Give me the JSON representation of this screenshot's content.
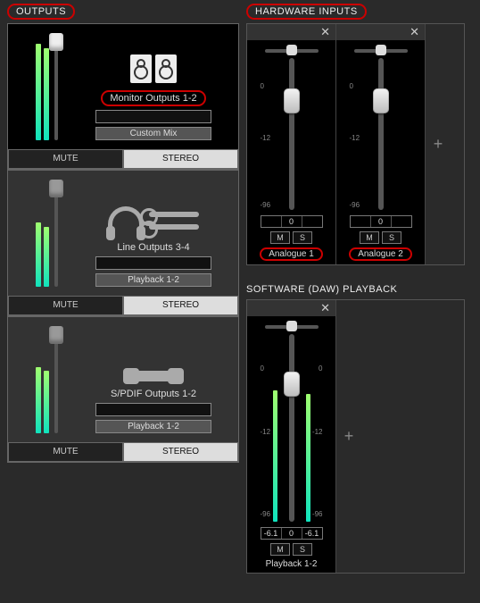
{
  "sections": {
    "outputs_title": "OUTPUTS",
    "hardware_title": "HARDWARE INPUTS",
    "software_title": "SOFTWARE (DAW) PLAYBACK"
  },
  "outputs": [
    {
      "label": "Monitor Outputs 1-2",
      "mix_label": "Custom Mix",
      "mute": "MUTE",
      "stereo": "STEREO",
      "meter_heights": [
        90,
        86
      ],
      "fader_light": true,
      "highlight": true
    },
    {
      "label": "Line Outputs 3-4",
      "mix_label": "Playback 1-2",
      "mute": "MUTE",
      "stereo": "STEREO",
      "meter_heights": [
        60,
        56
      ],
      "fader_light": false,
      "highlight": false
    },
    {
      "label": "S/PDIF Outputs 1-2",
      "mix_label": "Playback 1-2",
      "mute": "MUTE",
      "stereo": "STEREO",
      "meter_heights": [
        62,
        58
      ],
      "fader_light": false,
      "highlight": false
    }
  ],
  "db_scale": {
    "top": "0",
    "mid": "-12",
    "bot": "-96"
  },
  "hardware_inputs": [
    {
      "label": "Analogue 1",
      "value_center": "0",
      "m": "M",
      "s": "S",
      "fader_pos_pct": 20
    },
    {
      "label": "Analogue 2",
      "value_center": "0",
      "m": "M",
      "s": "S",
      "fader_pos_pct": 20
    }
  ],
  "software_playback": {
    "label": "Playback 1-2",
    "values": {
      "left": "-6.1",
      "center": "0",
      "right": "-6.1"
    },
    "m": "M",
    "s": "S",
    "fader_pos_pct": 20,
    "meter_heights": [
      70,
      68
    ]
  },
  "glyphs": {
    "close": "✕",
    "plus": "+"
  }
}
